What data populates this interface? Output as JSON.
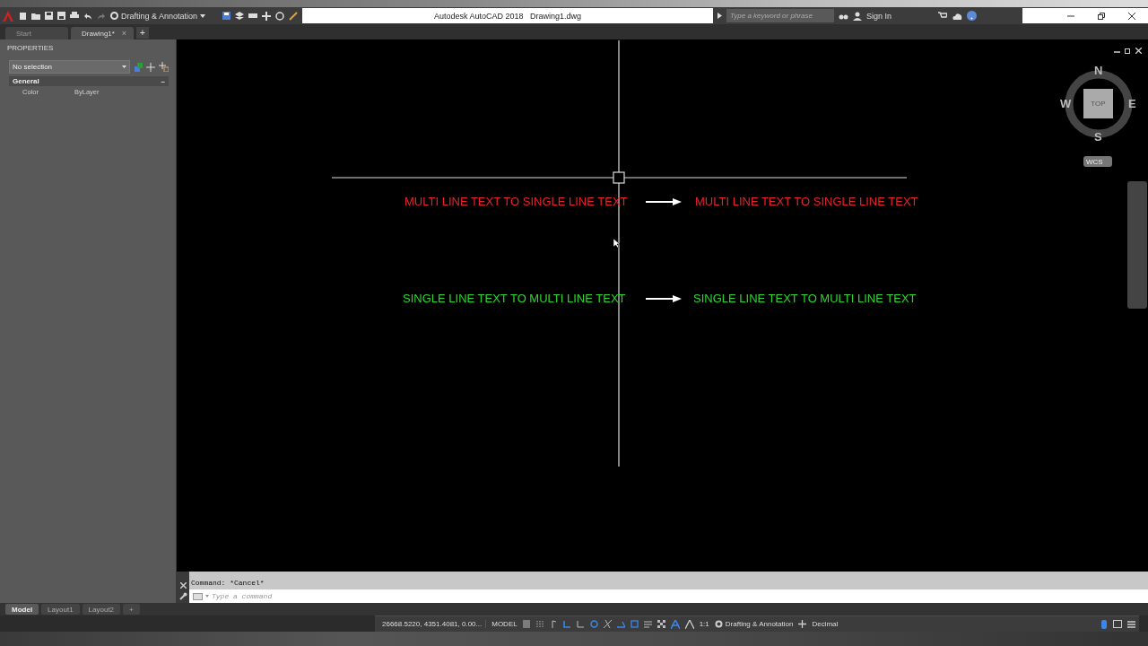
{
  "title_bar": {
    "workspace": "Drafting & Annotation",
    "title": "Autodesk AutoCAD 2018   Drawing1.dwg",
    "search": {
      "placeholder": "Type a keyword or phrase"
    },
    "sign_in": "Sign In"
  },
  "file_tabs": [
    {
      "label": "Start",
      "selected": false
    },
    {
      "label": "Drawing1*",
      "selected": true,
      "close": "×"
    }
  ],
  "new_tab": "+",
  "properties": {
    "title": "PROPERTIES",
    "selection": "No selection",
    "sections": [
      {
        "title": "General",
        "expanded": true,
        "toggle": "–",
        "rows": [
          {
            "label": "Color",
            "value": "ByLayer"
          }
        ]
      }
    ]
  },
  "drawing": {
    "rows": [
      {
        "color": "#e8232b",
        "source": "MULTI LINE TEXT TO SINGLE LINE TEXT",
        "result": "MULTI LINE TEXT TO SINGLE LINE TEXT"
      },
      {
        "color": "#2fd62f",
        "source": "SINGLE LINE TEXT TO MULTI LINE TEXT",
        "result": "SINGLE LINE TEXT TO MULTI LINE TEXT"
      }
    ]
  },
  "viewcube": {
    "north": "N",
    "south": "S",
    "east": "E",
    "west": "W",
    "face": "TOP",
    "ucs": "WCS"
  },
  "command_line": {
    "history": "Command: *Cancel*",
    "placeholder": "Type a command"
  },
  "layout_tabs": [
    {
      "label": "Model",
      "selected": true
    },
    {
      "label": "Layout1",
      "selected": false
    },
    {
      "label": "Layout2",
      "selected": false
    }
  ],
  "new_layout": "+",
  "status_bar": {
    "coordinates": "26668.5220, 4351.4081, 0.00...",
    "space": "MODEL",
    "scale": "1:1",
    "workspace": "Drafting & Annotation",
    "units": "Decimal",
    "toggles": [
      {
        "kind": "grid",
        "on": false
      },
      {
        "kind": "snap",
        "on": false
      },
      {
        "kind": "infer",
        "on": false
      },
      {
        "kind": "ortho",
        "on": true
      },
      {
        "kind": "polar",
        "on": false
      },
      {
        "kind": "osnap",
        "on": true
      },
      {
        "kind": "track",
        "on": false
      },
      {
        "kind": "dynamic",
        "on": true
      },
      {
        "kind": "ucs",
        "on": true
      },
      {
        "kind": "lineweight",
        "on": false
      },
      {
        "kind": "transparency",
        "on": false
      }
    ]
  }
}
